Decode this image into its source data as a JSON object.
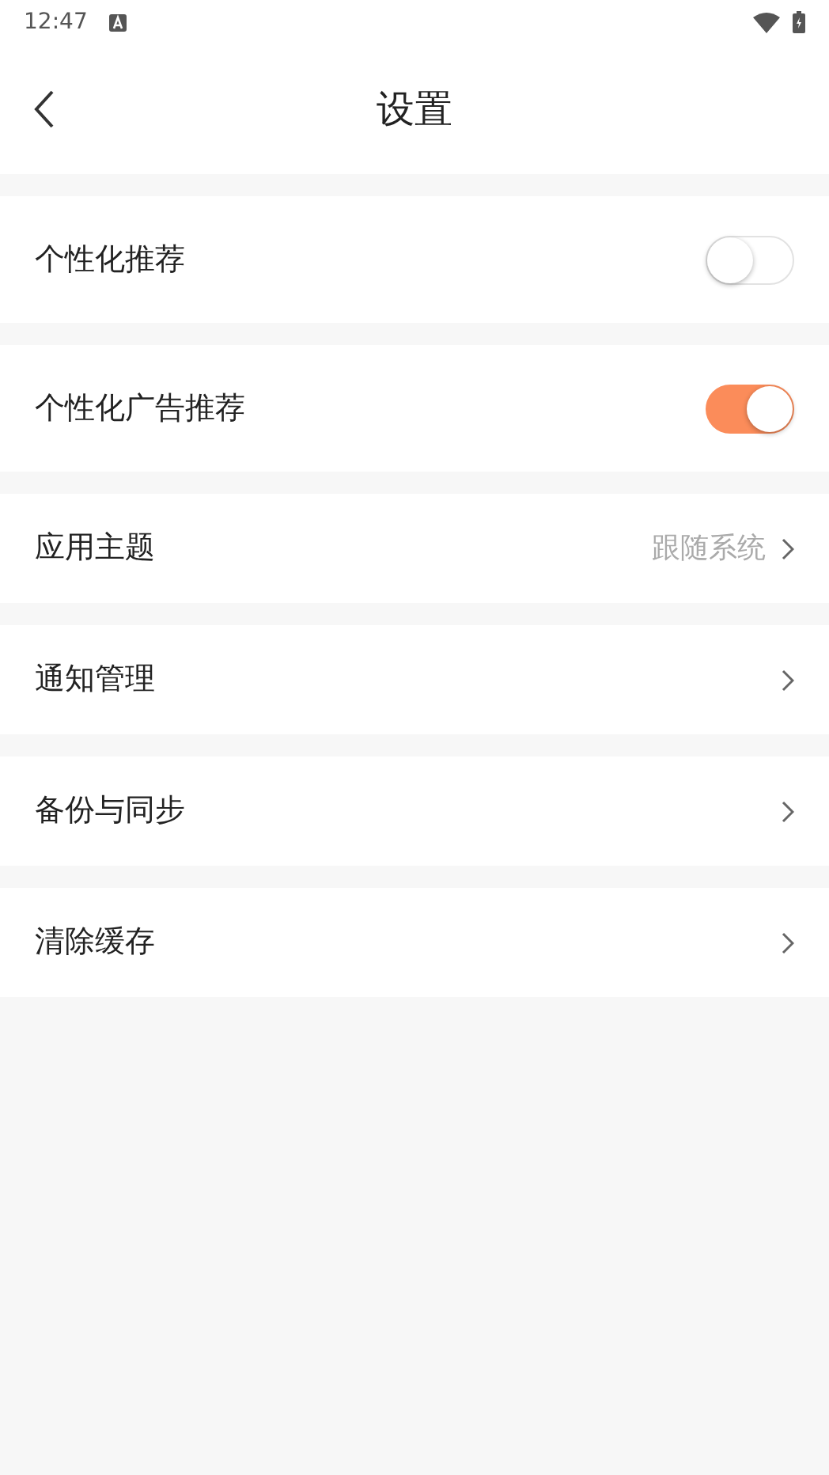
{
  "status_bar": {
    "time": "12:47"
  },
  "header": {
    "title": "设置"
  },
  "rows": [
    {
      "kind": "toggle",
      "label": "个性化推荐",
      "on": false
    },
    {
      "kind": "toggle",
      "label": "个性化广告推荐",
      "on": true
    },
    {
      "kind": "link",
      "label": "应用主题",
      "value": "跟随系统"
    },
    {
      "kind": "link",
      "label": "通知管理"
    },
    {
      "kind": "link",
      "label": "备份与同步"
    },
    {
      "kind": "link",
      "label": "清除缓存"
    }
  ]
}
